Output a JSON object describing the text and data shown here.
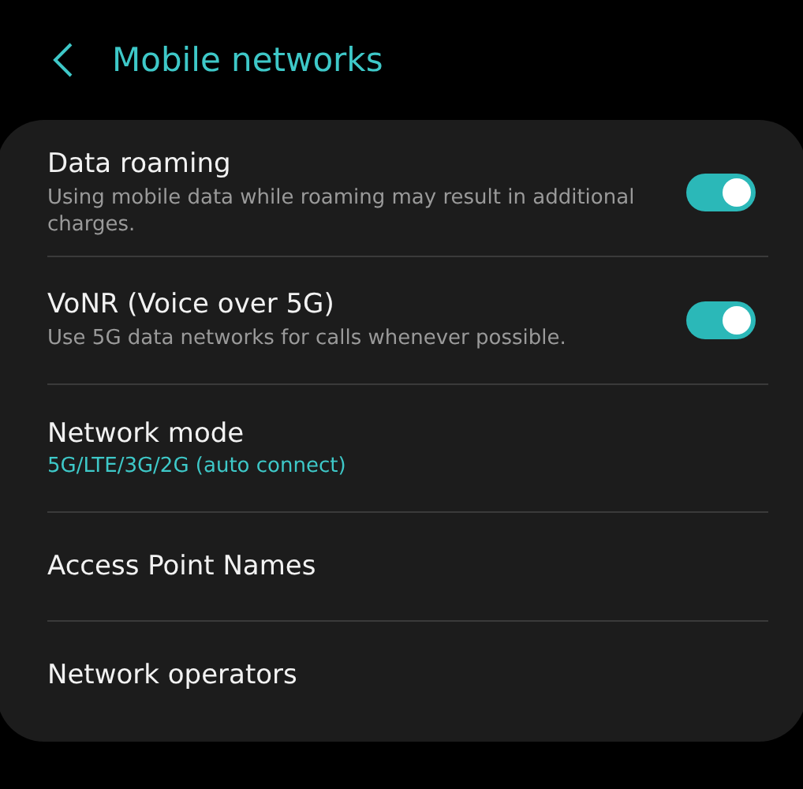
{
  "header": {
    "title": "Mobile networks"
  },
  "items": [
    {
      "kind": "toggle",
      "title": "Data roaming",
      "summary": "Using mobile data while roaming may result in additional charges.",
      "on": true
    },
    {
      "kind": "toggle",
      "title": "VoNR (Voice over 5G)",
      "summary": "Use 5G data networks for calls whenever possible.",
      "on": true
    },
    {
      "kind": "value",
      "title": "Network mode",
      "value": "5G/LTE/3G/2G (auto connect)"
    },
    {
      "kind": "plain",
      "title": "Access Point Names"
    },
    {
      "kind": "plain",
      "title": "Network operators"
    }
  ]
}
